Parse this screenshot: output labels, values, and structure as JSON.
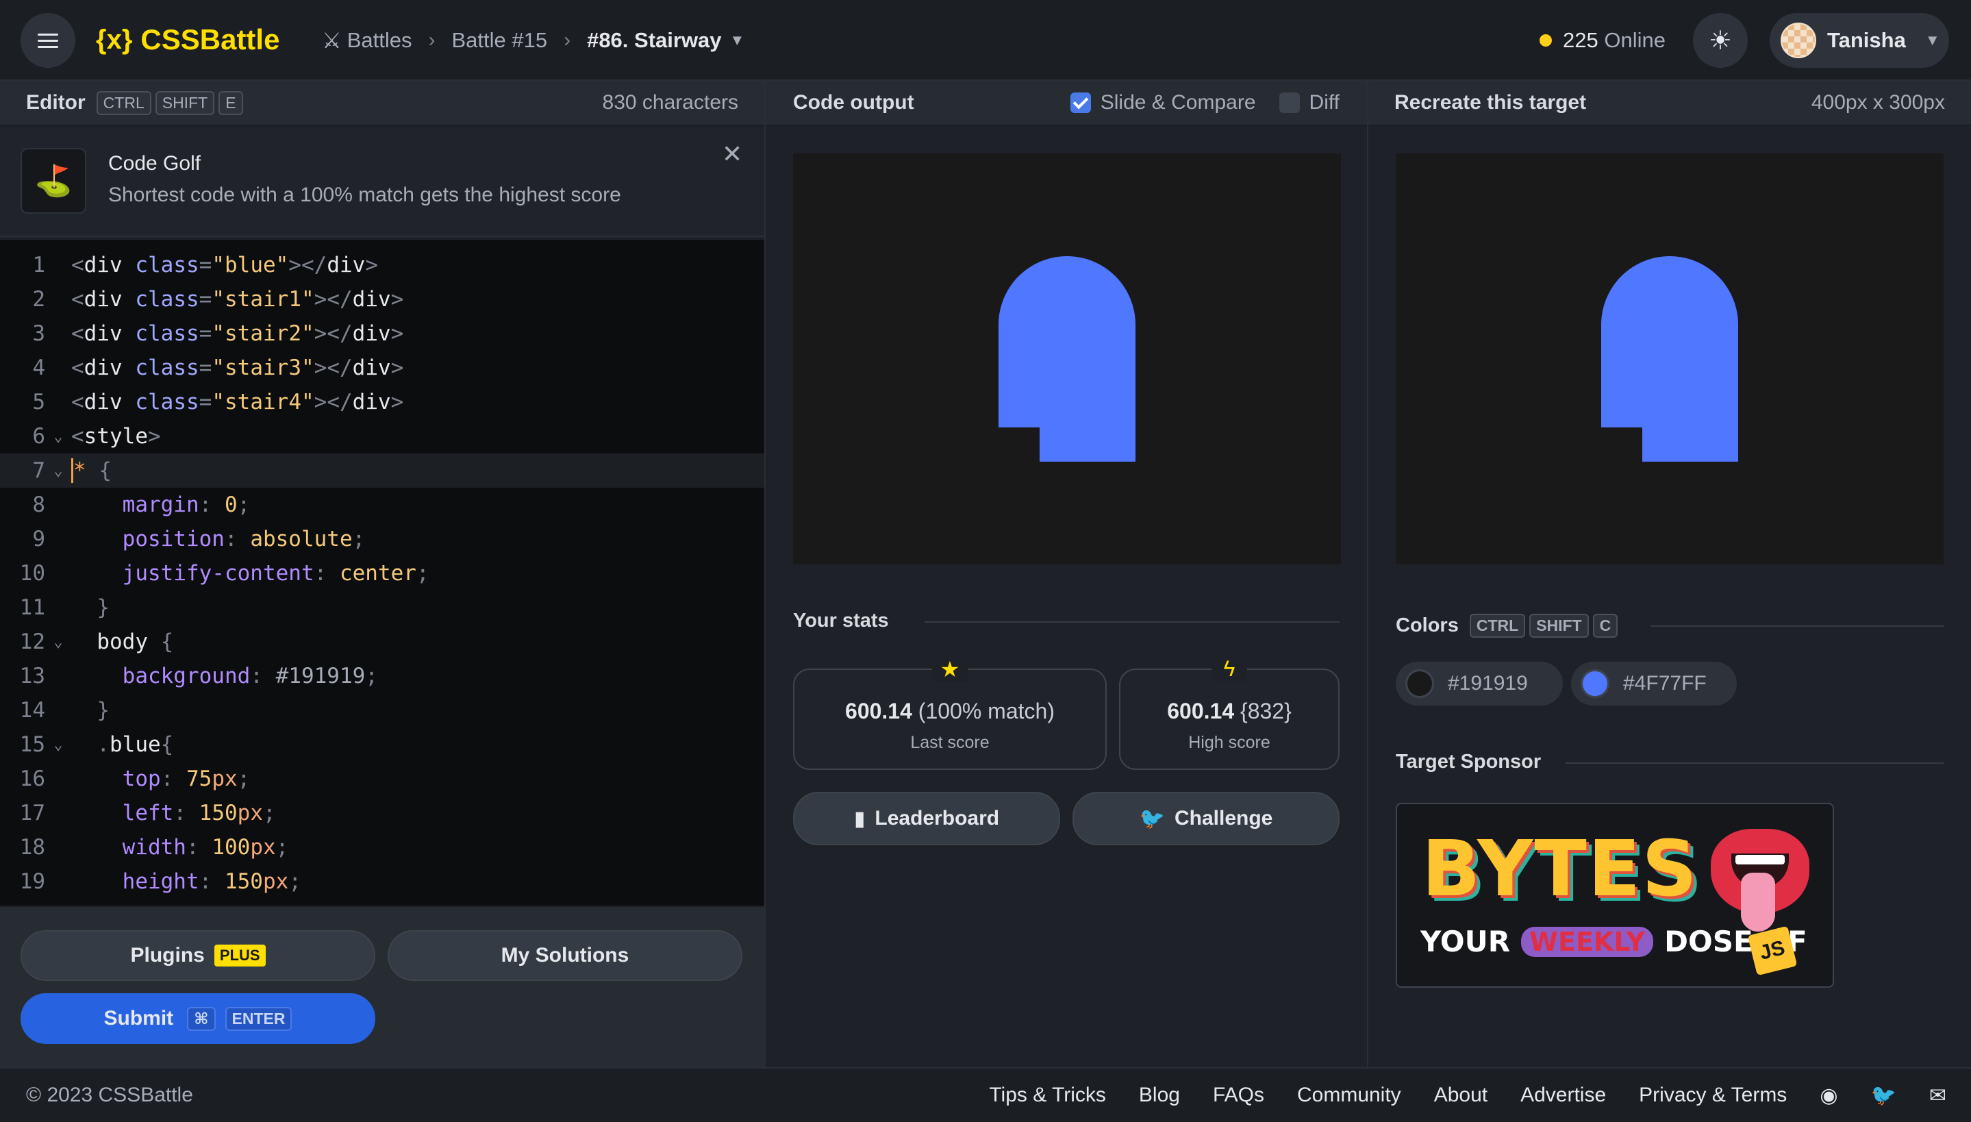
{
  "header": {
    "logo_mark": "{x}",
    "logo_text": "CSSBattle",
    "breadcrumbs": [
      "Battles",
      "Battle #15",
      "#86. Stairway"
    ],
    "online_count": "225",
    "online_label": "Online",
    "user_name": "Tanisha"
  },
  "editor": {
    "title": "Editor",
    "shortcut": [
      "CTRL",
      "SHIFT",
      "E"
    ],
    "char_count": "830 characters",
    "golf_title": "Code Golf",
    "golf_desc": "Shortest code with a 100% match gets the highest score",
    "lines": [
      "1",
      "2",
      "3",
      "4",
      "5",
      "6",
      "7",
      "8",
      "9",
      "10",
      "11",
      "12",
      "13",
      "14",
      "15",
      "16",
      "17",
      "18",
      "19"
    ]
  },
  "output": {
    "title": "Code output",
    "slide_compare_label": "Slide & Compare",
    "diff_label": "Diff",
    "stats_title": "Your stats",
    "last_score_value": "600.14",
    "last_score_match": "(100% match)",
    "last_score_label": "Last score",
    "high_score_value": "600.14",
    "high_score_chars": "{832}",
    "high_score_label": "High score",
    "leaderboard_label": "Leaderboard",
    "challenge_label": "Challenge"
  },
  "target": {
    "title": "Recreate this target",
    "size": "400px x 300px",
    "colors_title": "Colors",
    "colors_shortcut": [
      "CTRL",
      "SHIFT",
      "C"
    ],
    "colors": [
      {
        "hex": "#191919"
      },
      {
        "hex": "#4F77FF"
      }
    ],
    "sponsor_title": "Target Sponsor",
    "sponsor_name": "BYTES",
    "sponsor_tag_your": "YOUR",
    "sponsor_tag_weekly": "WEEKLY",
    "sponsor_tag_dose": "DOSE OF",
    "sponsor_tag_js": "JS"
  },
  "buttons": {
    "plugins": "Plugins",
    "plus": "PLUS",
    "my_solutions": "My Solutions",
    "submit": "Submit",
    "submit_kbd_cmd": "⌘",
    "submit_kbd_enter": "ENTER"
  },
  "footer": {
    "copyright": "© 2023 CSSBattle",
    "links": [
      "Tips & Tricks",
      "Blog",
      "FAQs",
      "Community",
      "About",
      "Advertise",
      "Privacy & Terms"
    ]
  }
}
